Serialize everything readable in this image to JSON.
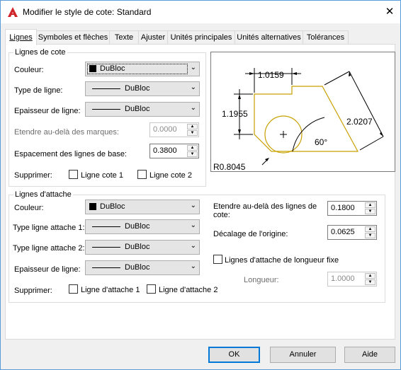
{
  "window": {
    "title": "Modifier le style de cote: Standard",
    "close_glyph": "✕"
  },
  "tabs": [
    "Lignes",
    "Symboles et flèches",
    "Texte",
    "Ajuster",
    "Unités principales",
    "Unités alternatives",
    "Tolérances"
  ],
  "dim_lines": {
    "group_title": "Lignes de cote",
    "color_label": "Couleur:",
    "color_value": "DuBloc",
    "linetype_label": "Type de ligne:",
    "linetype_value": "DuBloc",
    "lineweight_label": "Epaisseur de ligne:",
    "lineweight_value": "DuBloc",
    "extend_label": "Etendre au-delà des marques:",
    "extend_value": "0.0000",
    "baseline_label": "Espacement des lignes de base:",
    "baseline_value": "0.3800",
    "suppress_label": "Supprimer:",
    "suppress_1": "Ligne cote 1",
    "suppress_2": "Ligne cote 2"
  },
  "ext_lines": {
    "group_title": "Lignes d'attache",
    "color_label": "Couleur:",
    "color_value": "DuBloc",
    "type1_label": "Type ligne attache 1:",
    "type1_value": "DuBloc",
    "type2_label": "Type ligne attache 2:",
    "type2_value": "DuBloc",
    "lineweight_label": "Epaisseur de ligne:",
    "lineweight_value": "DuBloc",
    "suppress_label": "Supprimer:",
    "suppress_1": "Ligne d'attache 1",
    "suppress_2": "Ligne d'attache 2",
    "extend_label_1": "Etendre au-delà des lignes de",
    "extend_label_2": "cote:",
    "extend_value": "0.1800",
    "offset_label": "Décalage de l'origine:",
    "offset_value": "0.0625",
    "fixed_label": "Lignes d'attache de longueur fixe",
    "length_label": "Longueur:",
    "length_value": "1.0000"
  },
  "preview": {
    "dim_top": "1.0159",
    "dim_left": "1.1955",
    "dim_right": "2.0207",
    "angle": "60°",
    "radius": "R0.8045"
  },
  "buttons": {
    "ok": "OK",
    "cancel": "Annuler",
    "help": "Aide"
  },
  "colors": {
    "accent": "#0078d7",
    "app_icon": "#d0252a",
    "preview_shape": "#c8a000"
  }
}
